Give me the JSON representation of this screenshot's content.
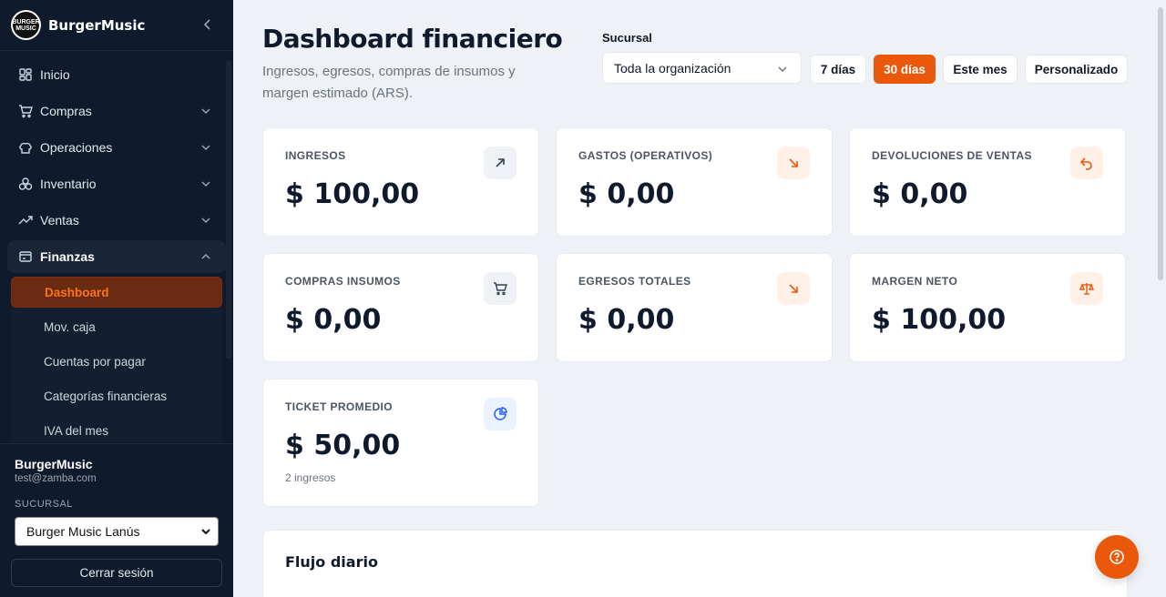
{
  "app": {
    "name": "BurgerMusic",
    "logo_text": "BURGER MUSIC"
  },
  "sidebar": {
    "items": [
      {
        "label": "Inicio",
        "icon": "grid-icon"
      },
      {
        "label": "Compras",
        "icon": "cart-icon"
      },
      {
        "label": "Operaciones",
        "icon": "chef-hat-icon"
      },
      {
        "label": "Inventario",
        "icon": "boxes-icon"
      },
      {
        "label": "Ventas",
        "icon": "trend-up-icon"
      },
      {
        "label": "Finanzas",
        "icon": "wallet-icon"
      }
    ],
    "finanzas_sub": [
      "Dashboard",
      "Mov. caja",
      "Cuentas por pagar",
      "Categorías financieras",
      "IVA del mes"
    ],
    "active_sub": "Dashboard"
  },
  "user": {
    "name": "BurgerMusic",
    "email": "test@zamba.com",
    "sucursal_label": "SUCURSAL",
    "sucursal_value": "Burger Music Lanús",
    "logout_label": "Cerrar sesión"
  },
  "header": {
    "title": "Dashboard financiero",
    "subtitle": "Ingresos, egresos, compras de insumos y margen estimado (ARS).",
    "filter_label": "Sucursal",
    "filter_value": "Toda la organización",
    "ranges": [
      "7 días",
      "30 días",
      "Este mes",
      "Personalizado"
    ],
    "active_range": "30 días"
  },
  "cards": [
    {
      "label": "INGRESOS",
      "value": "$ 100,00",
      "icon": "arrow-up-right-icon"
    },
    {
      "label": "GASTOS (OPERATIVOS)",
      "value": "$ 0,00",
      "icon": "arrow-down-right-icon"
    },
    {
      "label": "DEVOLUCIONES DE VENTAS",
      "value": "$ 0,00",
      "icon": "undo-icon"
    },
    {
      "label": "COMPRAS INSUMOS",
      "value": "$ 0,00",
      "icon": "cart-icon"
    },
    {
      "label": "EGRESOS TOTALES",
      "value": "$ 0,00",
      "icon": "arrow-down-right-icon"
    },
    {
      "label": "MARGEN NETO",
      "value": "$ 100,00",
      "icon": "scale-icon"
    },
    {
      "label": "TICKET PROMEDIO",
      "value": "$ 50,00",
      "note": "2 ingresos",
      "icon": "pie-chart-icon"
    }
  ],
  "flow": {
    "title": "Flujo diario"
  },
  "colors": {
    "accent": "#ea580c",
    "sidebar_bg": "#0f1b2d",
    "page_bg": "#eef1f6"
  }
}
